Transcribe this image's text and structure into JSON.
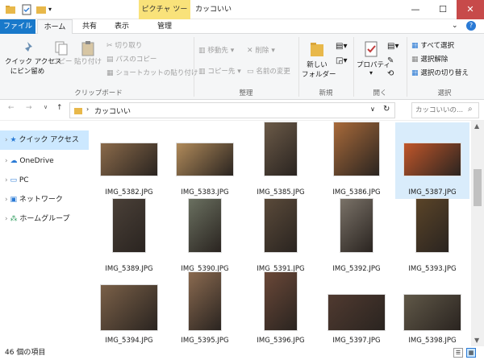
{
  "window": {
    "title": "カッコいい",
    "contextual_tab": "ピクチャ ツール",
    "minimize_glyph": "—",
    "maximize_glyph": "☐",
    "close_glyph": "✕"
  },
  "tabs": [
    "ファイル",
    "ホーム",
    "共有",
    "表示",
    "管理"
  ],
  "ribbon": {
    "clipboard": {
      "pin_label1": "クイック アクセス",
      "pin_label2": "にピン留め",
      "copy": "コピー",
      "paste": "貼り付け",
      "cut": "切り取り",
      "copy_path": "パスのコピー",
      "paste_shortcut": "ショートカットの貼り付け",
      "group": "クリップボード"
    },
    "organize": {
      "move_to": "移動先",
      "copy_to": "コピー先",
      "delete": "削除",
      "rename": "名前の変更",
      "group": "整理"
    },
    "new": {
      "new_folder1": "新しい",
      "new_folder2": "フォルダー",
      "group": "新規"
    },
    "open": {
      "properties": "プロパティ",
      "group": "開く"
    },
    "select": {
      "select_all": "すべて選択",
      "select_none": "選択解除",
      "invert": "選択の切り替え",
      "group": "選択"
    }
  },
  "address": {
    "path": "カッコいい",
    "search_placeholder": "カッコいいの..."
  },
  "nav": {
    "items": [
      "クイック アクセス",
      "OneDrive",
      "PC",
      "ネットワーク",
      "ホームグループ"
    ]
  },
  "files": [
    {
      "name": "IMG_5382.JPG",
      "color": "#8a6a4a"
    },
    {
      "name": "IMG_5383.JPG",
      "color": "#b08a5a"
    },
    {
      "name": "IMG_5385.JPG",
      "color": "#6b5a48"
    },
    {
      "name": "IMG_5386.JPG",
      "color": "#a86a3a"
    },
    {
      "name": "IMG_5387.JPG",
      "color": "#c0562a"
    },
    {
      "name": "IMG_5389.JPG",
      "color": "#4a4038"
    },
    {
      "name": "IMG_5390.JPG",
      "color": "#6a7060"
    },
    {
      "name": "IMG_5391.JPG",
      "color": "#5a4a3a"
    },
    {
      "name": "IMG_5392.JPG",
      "color": "#7a7268"
    },
    {
      "name": "IMG_5393.JPG",
      "color": "#5a4428"
    },
    {
      "name": "IMG_5394.JPG",
      "color": "#7a6048"
    },
    {
      "name": "IMG_5395.JPG",
      "color": "#8a6a50"
    },
    {
      "name": "IMG_5396.JPG",
      "color": "#6a4838"
    },
    {
      "name": "IMG_5397.JPG",
      "color": "#503a30"
    },
    {
      "name": "IMG_5398.JPG",
      "color": "#605848"
    }
  ],
  "status": {
    "count": "46 個の項目"
  }
}
